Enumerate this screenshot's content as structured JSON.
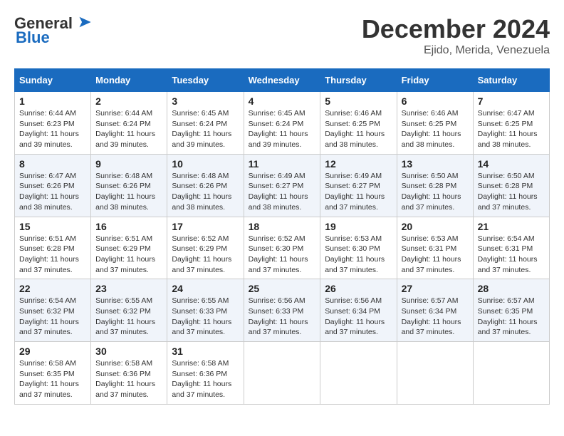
{
  "logo": {
    "line1": "General",
    "line2": "Blue"
  },
  "header": {
    "month": "December 2024",
    "location": "Ejido, Merida, Venezuela"
  },
  "days_of_week": [
    "Sunday",
    "Monday",
    "Tuesday",
    "Wednesday",
    "Thursday",
    "Friday",
    "Saturday"
  ],
  "weeks": [
    [
      {
        "day": "1",
        "sunrise": "6:44 AM",
        "sunset": "6:23 PM",
        "daylight": "11 hours and 39 minutes."
      },
      {
        "day": "2",
        "sunrise": "6:44 AM",
        "sunset": "6:24 PM",
        "daylight": "11 hours and 39 minutes."
      },
      {
        "day": "3",
        "sunrise": "6:45 AM",
        "sunset": "6:24 PM",
        "daylight": "11 hours and 39 minutes."
      },
      {
        "day": "4",
        "sunrise": "6:45 AM",
        "sunset": "6:24 PM",
        "daylight": "11 hours and 39 minutes."
      },
      {
        "day": "5",
        "sunrise": "6:46 AM",
        "sunset": "6:25 PM",
        "daylight": "11 hours and 38 minutes."
      },
      {
        "day": "6",
        "sunrise": "6:46 AM",
        "sunset": "6:25 PM",
        "daylight": "11 hours and 38 minutes."
      },
      {
        "day": "7",
        "sunrise": "6:47 AM",
        "sunset": "6:25 PM",
        "daylight": "11 hours and 38 minutes."
      }
    ],
    [
      {
        "day": "8",
        "sunrise": "6:47 AM",
        "sunset": "6:26 PM",
        "daylight": "11 hours and 38 minutes."
      },
      {
        "day": "9",
        "sunrise": "6:48 AM",
        "sunset": "6:26 PM",
        "daylight": "11 hours and 38 minutes."
      },
      {
        "day": "10",
        "sunrise": "6:48 AM",
        "sunset": "6:26 PM",
        "daylight": "11 hours and 38 minutes."
      },
      {
        "day": "11",
        "sunrise": "6:49 AM",
        "sunset": "6:27 PM",
        "daylight": "11 hours and 38 minutes."
      },
      {
        "day": "12",
        "sunrise": "6:49 AM",
        "sunset": "6:27 PM",
        "daylight": "11 hours and 37 minutes."
      },
      {
        "day": "13",
        "sunrise": "6:50 AM",
        "sunset": "6:28 PM",
        "daylight": "11 hours and 37 minutes."
      },
      {
        "day": "14",
        "sunrise": "6:50 AM",
        "sunset": "6:28 PM",
        "daylight": "11 hours and 37 minutes."
      }
    ],
    [
      {
        "day": "15",
        "sunrise": "6:51 AM",
        "sunset": "6:28 PM",
        "daylight": "11 hours and 37 minutes."
      },
      {
        "day": "16",
        "sunrise": "6:51 AM",
        "sunset": "6:29 PM",
        "daylight": "11 hours and 37 minutes."
      },
      {
        "day": "17",
        "sunrise": "6:52 AM",
        "sunset": "6:29 PM",
        "daylight": "11 hours and 37 minutes."
      },
      {
        "day": "18",
        "sunrise": "6:52 AM",
        "sunset": "6:30 PM",
        "daylight": "11 hours and 37 minutes."
      },
      {
        "day": "19",
        "sunrise": "6:53 AM",
        "sunset": "6:30 PM",
        "daylight": "11 hours and 37 minutes."
      },
      {
        "day": "20",
        "sunrise": "6:53 AM",
        "sunset": "6:31 PM",
        "daylight": "11 hours and 37 minutes."
      },
      {
        "day": "21",
        "sunrise": "6:54 AM",
        "sunset": "6:31 PM",
        "daylight": "11 hours and 37 minutes."
      }
    ],
    [
      {
        "day": "22",
        "sunrise": "6:54 AM",
        "sunset": "6:32 PM",
        "daylight": "11 hours and 37 minutes."
      },
      {
        "day": "23",
        "sunrise": "6:55 AM",
        "sunset": "6:32 PM",
        "daylight": "11 hours and 37 minutes."
      },
      {
        "day": "24",
        "sunrise": "6:55 AM",
        "sunset": "6:33 PM",
        "daylight": "11 hours and 37 minutes."
      },
      {
        "day": "25",
        "sunrise": "6:56 AM",
        "sunset": "6:33 PM",
        "daylight": "11 hours and 37 minutes."
      },
      {
        "day": "26",
        "sunrise": "6:56 AM",
        "sunset": "6:34 PM",
        "daylight": "11 hours and 37 minutes."
      },
      {
        "day": "27",
        "sunrise": "6:57 AM",
        "sunset": "6:34 PM",
        "daylight": "11 hours and 37 minutes."
      },
      {
        "day": "28",
        "sunrise": "6:57 AM",
        "sunset": "6:35 PM",
        "daylight": "11 hours and 37 minutes."
      }
    ],
    [
      {
        "day": "29",
        "sunrise": "6:58 AM",
        "sunset": "6:35 PM",
        "daylight": "11 hours and 37 minutes."
      },
      {
        "day": "30",
        "sunrise": "6:58 AM",
        "sunset": "6:36 PM",
        "daylight": "11 hours and 37 minutes."
      },
      {
        "day": "31",
        "sunrise": "6:58 AM",
        "sunset": "6:36 PM",
        "daylight": "11 hours and 37 minutes."
      },
      null,
      null,
      null,
      null
    ]
  ],
  "labels": {
    "sunrise": "Sunrise:",
    "sunset": "Sunset:",
    "daylight": "Daylight:"
  }
}
